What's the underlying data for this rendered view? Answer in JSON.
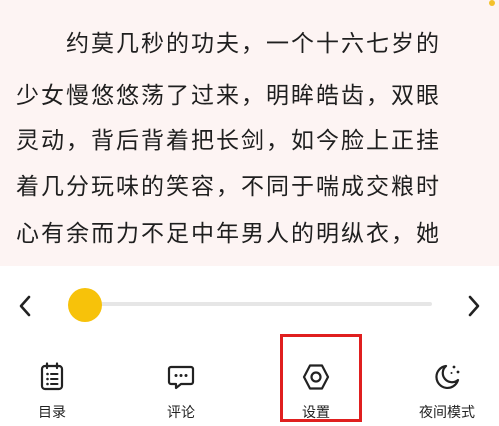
{
  "reader": {
    "lines": [
      "　　约莫几秒的功夫，一个十六七岁的",
      "少女慢悠悠荡了过来，明眸皓齿，双眼",
      "灵动，背后背着把长剑，如今脸上正挂",
      "着几分玩味的笑容，不同于喘成交粮时",
      "心有余而力不足中年男人的明纵衣，她"
    ]
  },
  "progress": {
    "value": 0.0
  },
  "menu": {
    "items": [
      {
        "label": "目录",
        "icon": "table-of-contents-icon"
      },
      {
        "label": "评论",
        "icon": "comment-icon"
      },
      {
        "label": "设置",
        "icon": "settings-icon"
      },
      {
        "label": "夜间模式",
        "icon": "night-mode-icon"
      }
    ]
  },
  "colors": {
    "reader_background": "#fdf4f3",
    "accent": "#f7c20a",
    "highlight": "#e01f1f"
  }
}
